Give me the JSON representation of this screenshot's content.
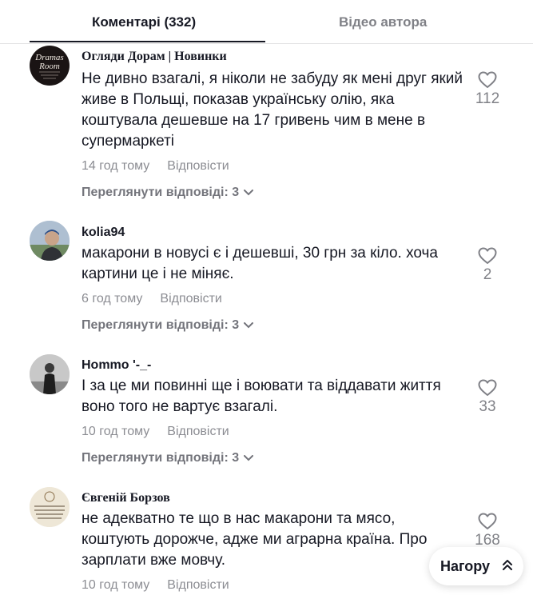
{
  "tabs": {
    "comments_label": "Коментарі (332)",
    "videos_label": "Відео автора"
  },
  "comments": [
    {
      "username": "Огляди Дорам | Новинки",
      "avatar_text_1": "Dramas",
      "avatar_text_2": "Room",
      "avatar_text_3": "REVIEW OF DRAMAS · EXCLUSIVE NEWS",
      "text": "Не дивно взагалі, я ніколи не забуду як мені друг який живе в Польщі, показав українську олію, яка коштувала дешевше на 17 гривень чим в мене в супермаркеті",
      "time": "14 год тому",
      "reply_label": "Відповісти",
      "view_replies": "Переглянути відповіді: 3",
      "likes": "112"
    },
    {
      "username": "kolia94",
      "text": "макарони в новусі є і дешевші, 30 грн за кіло. хоча картини це і не міняє.",
      "time": "6 год тому",
      "reply_label": "Відповісти",
      "view_replies": "Переглянути відповіді: 3",
      "likes": "2"
    },
    {
      "username": "Hommo '-_-",
      "text": "І за це ми повинні ще і воювати та віддавати життя воно того не вартує взагалі.",
      "time": "10 год тому",
      "reply_label": "Відповісти",
      "view_replies": "Переглянути відповіді: 3",
      "likes": "33"
    },
    {
      "username": "Євгеній Борзов",
      "text": "не адекватно те що в нас макарони та мясо, коштують дорожче, адже ми аграрна країна. Про зарплати вже мовчу.",
      "time": "10 год тому",
      "reply_label": "Відповісти",
      "likes": "168"
    }
  ],
  "back_to_top_label": "Нагору",
  "icons": {
    "like": "heart-outline-icon",
    "expand": "chevron-down-icon",
    "top": "double-chevron-up-icon"
  }
}
